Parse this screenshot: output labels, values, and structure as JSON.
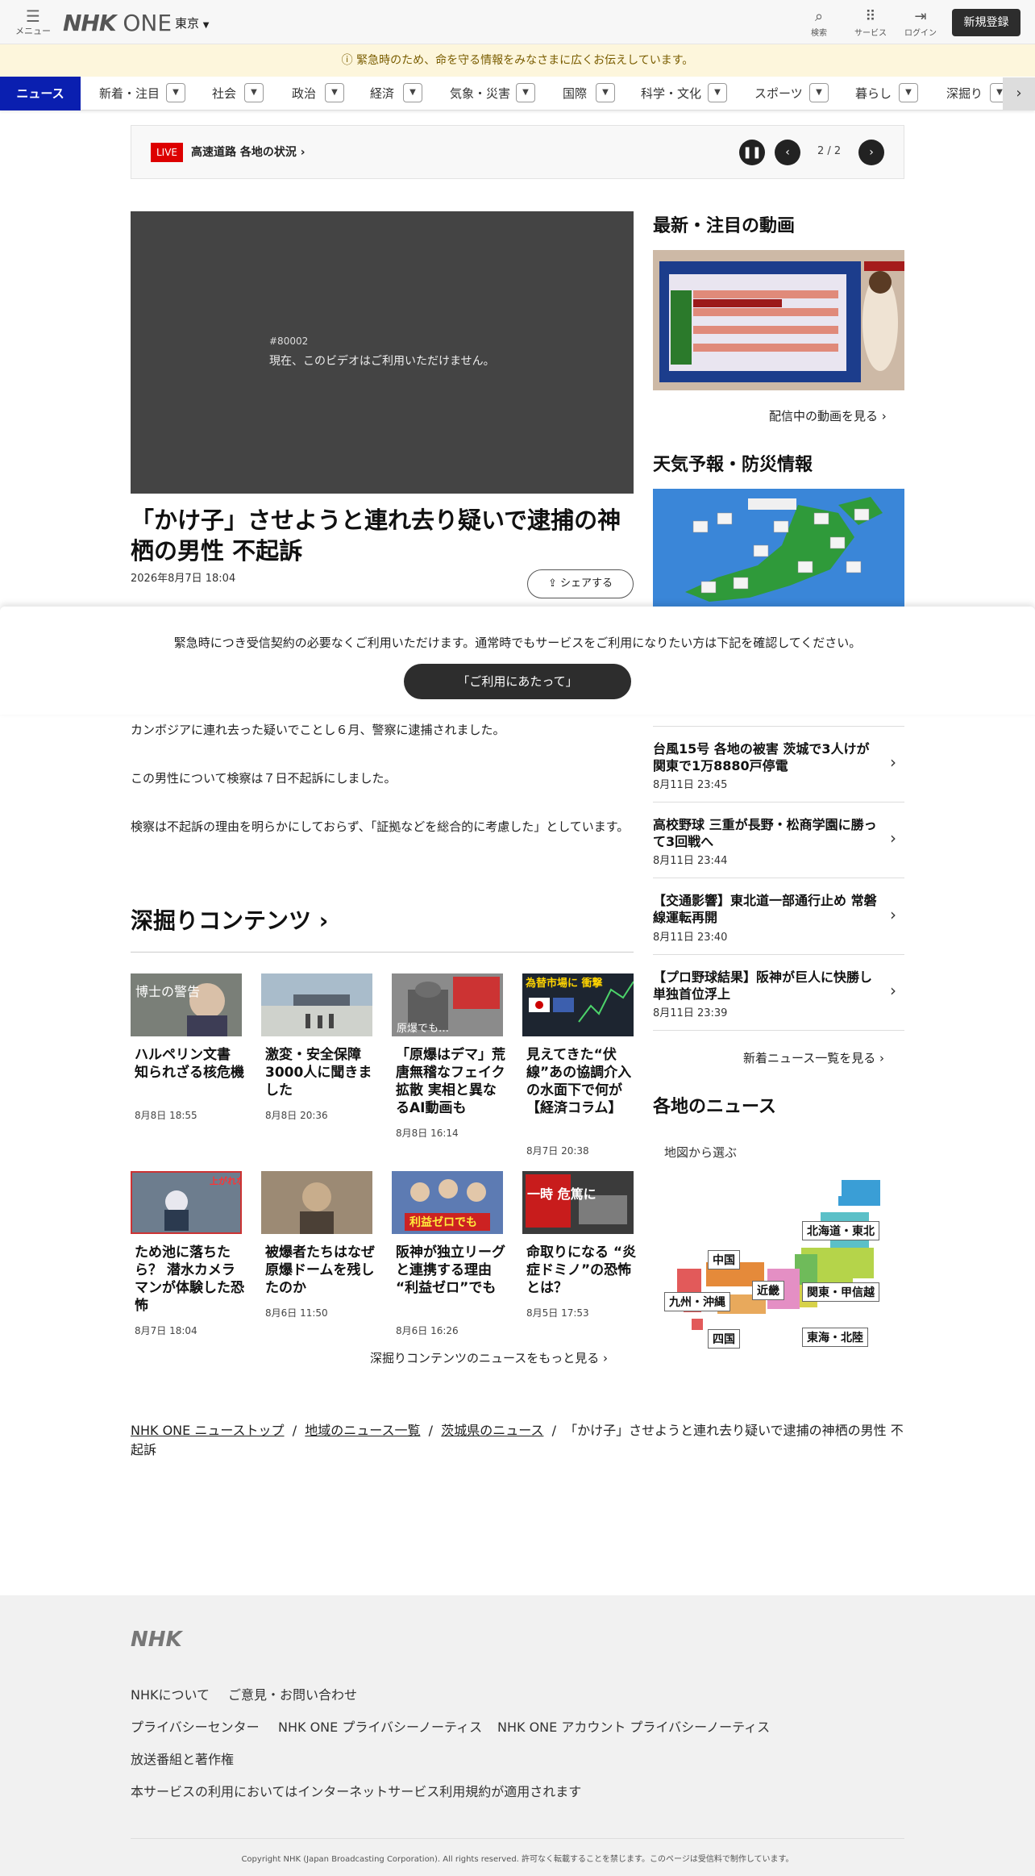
{
  "header": {
    "menu_label": "メニュー",
    "logo": "NHK",
    "logo_suffix": "ONE",
    "region": "東京",
    "search_label": "検索",
    "services_label": "サービス",
    "login_label": "ログイン",
    "signup_label": "新規登録"
  },
  "alert": "緊急時のため、命を守る情報をみなさまに広くお伝えしています。",
  "nav": {
    "active": "ニュース",
    "items": [
      "新着・注目",
      "社会",
      "政治",
      "経済",
      "気象・災害",
      "国際",
      "科学・文化",
      "スポーツ",
      "暮らし",
      "深掘り"
    ]
  },
  "live": {
    "badge": "LIVE",
    "text": "高速道路 各地の状況",
    "pager": "2 / 2"
  },
  "video": {
    "code": "#80002",
    "message": "現在、このビデオはご利用いただけません。"
  },
  "article": {
    "title": "「かけ子」させようと連れ去り疑いで逮捕の神栖の男性 不起訴",
    "date": "2026年8月7日 18:04",
    "share": "シェアする",
    "paragraphs": [
      "カンボジアに連れ去った疑いでことし６月、警察に逮捕されました。",
      "この男性について検察は７日不起訴にしました。",
      "検察は不起訴の理由を明らかにしておらず、「証拠などを総合的に考慮した」としています。"
    ]
  },
  "overlay": {
    "message": "緊急時につき受信契約の必要なくご利用いただけます。通常時でもサービスをご利用になりたい方は下記を確認してください。",
    "button": "「ご利用にあたって」"
  },
  "sidebar": {
    "video_title": "最新・注目の動画",
    "video_more": "配信中の動画を見る",
    "weather_title": "天気予報・防災情報",
    "news": [
      {
        "title": "台風15号 各地の被害 茨城で3人けが 関東で1万8880戸停電",
        "date": "8月11日 23:45"
      },
      {
        "title": "高校野球 三重が長野・松商学園に勝って3回戦へ",
        "date": "8月11日 23:44"
      },
      {
        "title": "【交通影響】東北道一部通行止め 常磐線運転再開",
        "date": "8月11日 23:40"
      },
      {
        "title": "【プロ野球結果】阪神が巨人に快勝し単独首位浮上",
        "date": "8月11日 23:39"
      }
    ],
    "news_more": "新着ニュース一覧を見る",
    "regional_title": "各地のニュース",
    "map_label": "地図から選ぶ",
    "regions": [
      "北海道・東北",
      "関東・甲信越",
      "東海・北陸",
      "近畿",
      "中国",
      "四国",
      "九州・沖縄"
    ]
  },
  "deep": {
    "title": "深掘りコンテンツ",
    "cards": [
      {
        "title": "ハルペリン文書 知られざる核危機",
        "date": "8月8日 18:55",
        "img_text": "博士の警告"
      },
      {
        "title": "激変・安全保障 3000人に聞きました",
        "date": "8月8日 20:36",
        "img_text": ""
      },
      {
        "title": "「原爆はデマ」荒唐無稽なフェイク拡散 実相と異なるAI動画も",
        "date": "8月8日 16:14",
        "img_text": "原爆でも…"
      },
      {
        "title": "見えてきた“伏線”あの協調介入の水面下で何が【経済コラム】",
        "date": "8月7日 20:38",
        "img_text": "為替市場に 衝撃"
      },
      {
        "title": "ため池に落ちたら？ 潜水カメラマンが体験した恐怖",
        "date": "8月7日 18:04",
        "img_text": "上がれない"
      },
      {
        "title": "被爆者たちはなぜ原爆ドームを残したのか",
        "date": "8月6日 11:50",
        "img_text": ""
      },
      {
        "title": "阪神が独立リーグと連携する理由 “利益ゼロ”でも",
        "date": "8月6日 16:26",
        "img_text": "利益ゼロでも"
      },
      {
        "title": "命取りになる “炎症ドミノ”の恐怖とは？",
        "date": "8月5日 17:53",
        "img_text": "一時 危篤に"
      }
    ],
    "more": "深掘りコンテンツのニュースをもっと見る"
  },
  "breadcrumb": {
    "items": [
      "NHK ONE ニューストップ",
      "地域のニュース一覧",
      "茨城県のニュース"
    ],
    "current": "「かけ子」させようと連れ去り疑いで逮捕の神栖の男性 不起訴",
    "sep": "/"
  },
  "footer": {
    "logo": "NHK",
    "links_row1": [
      "NHKについて",
      "ご意見・お問い合わせ"
    ],
    "links_row2": [
      "プライバシーセンター",
      "NHK ONE プライバシーノーティス",
      "NHK ONE アカウント プライバシーノーティス"
    ],
    "link_row3": "放送番組と著作権",
    "link_row4": "本サービスの利用においてはインターネットサービス利用規約が適用されます",
    "copyright": "Copyright NHK (Japan Broadcasting Corporation). All rights reserved. 許可なく転載することを禁じます。このページは受信料で制作しています。"
  },
  "colors": {
    "nav_active": "#0a1fb0",
    "live_badge": "#dd0000",
    "alert_bg": "#fdf6dc"
  }
}
